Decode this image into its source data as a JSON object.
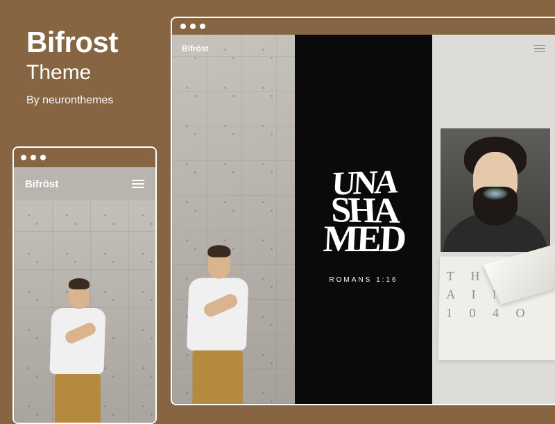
{
  "header": {
    "title": "Bifrost",
    "subtitle": "Theme",
    "author": "By neuronthemes"
  },
  "mobile": {
    "brand": "Bifröst"
  },
  "desktop": {
    "brand": "Bifröst",
    "panel2": {
      "line1": "UNA",
      "line2": "SHA",
      "line3": "MED",
      "verse": "ROMANS 1:16"
    },
    "panel3": {
      "typography": "T H E R A I N 8 1 0 4 O"
    }
  },
  "colors": {
    "bg": "#876543",
    "panel2_bg": "#0a0a0a",
    "panel3_bg": "#dedcd9"
  }
}
